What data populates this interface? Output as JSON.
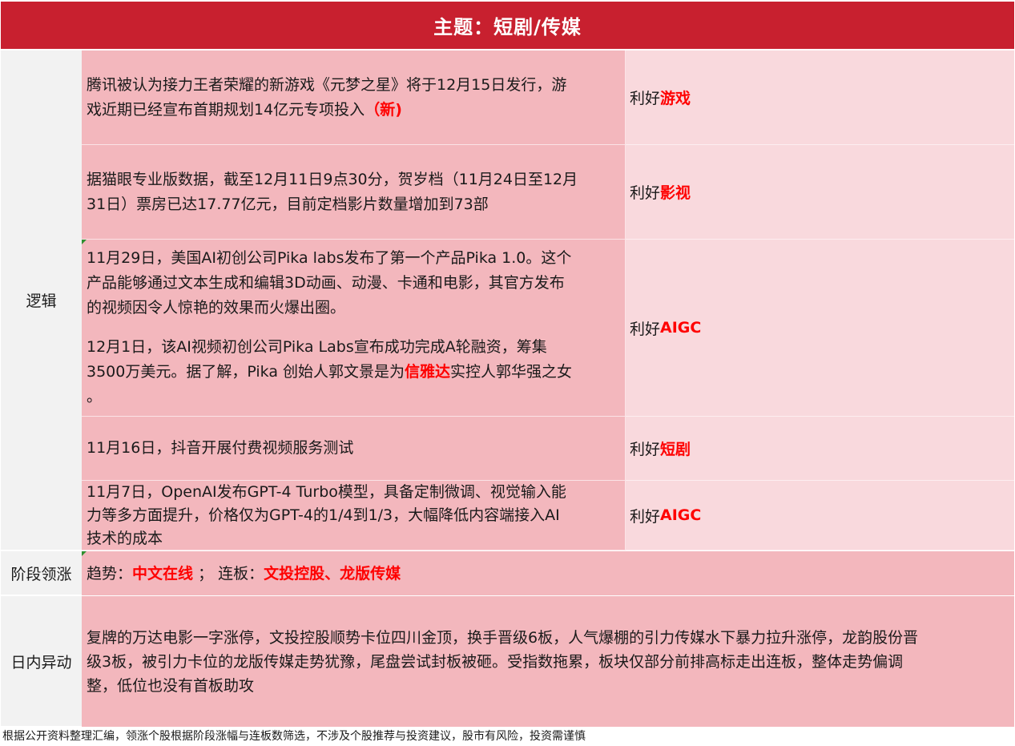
{
  "header": {
    "title": "主题：短剧/传媒"
  },
  "labels": {
    "logic": "逻辑",
    "stage": "阶段领涨",
    "intraday": "日内异动"
  },
  "rows": [
    {
      "lines": [
        "腾讯被认为接力王者荣耀的新游戏《元梦之星》将于12月15日发行，游",
        "戏近期已经宣布首期规划14亿元专项投入"
      ],
      "tag": "（新)",
      "impact_prefix": "利好",
      "impact_target": "游戏"
    },
    {
      "lines": [
        "据猫眼专业版数据，截至12月11日9点30分，贺岁档（11月24日至12月",
        "31日）票房已达17.77亿元，目前定档影片数量增加到73部"
      ],
      "impact_prefix": "利好",
      "impact_target": "影视"
    },
    {
      "para1": [
        "11月29日，美国AI初创公司Pika labs发布了第一个产品Pika 1.0。这个",
        "产品能够通过文本生成和编辑3D动画、动漫、卡通和电影，其官方发布",
        "的视频因令人惊艳的效果而火爆出圈。"
      ],
      "para2_line1": "12月1日，该AI视频初创公司Pika Labs宣布成功完成A轮融资，筹集",
      "para2_line2_pre": "3500万美元。据了解，Pika 创始人郭文景是为",
      "para2_highlight": "信雅达",
      "para2_line2_post": "实控人郭华强之女",
      "para2_line3": "。",
      "impact_prefix": "利好",
      "impact_target": "AIGC"
    },
    {
      "lines": [
        "11月16日，抖音开展付费视频服务测试"
      ],
      "impact_prefix": "利好",
      "impact_target": "短剧"
    },
    {
      "lines": [
        "11月7日，OpenAI发布GPT-4 Turbo模型，具备定制微调、视觉输入能",
        "力等多方面提升，价格仅为GPT-4的1/4到1/3，大幅降低内容端接入AI",
        "技术的成本"
      ],
      "impact_prefix": "利好",
      "impact_target": "AIGC"
    }
  ],
  "stage": {
    "trend_label": "趋势：",
    "trend_value": "中文在线",
    "separator": "；",
    "board_label": "连板：",
    "board_value": "文投控股、龙版传媒"
  },
  "intraday": {
    "lines": [
      "复牌的万达电影一字涨停，文投控股顺势卡位四川金顶，换手晋级6板，人气爆棚的引力传媒水下暴力拉升涨停，龙韵股份晋",
      "级3板，被引力卡位的龙版传媒走势犹豫，尾盘尝试封板被砸。受指数拖累，板块仅部分前排高标走出连板，整体走势偏调",
      "整，低位也没有首板助攻"
    ]
  },
  "footer": {
    "disclaimer": "根据公开资料整理汇编，领涨个股根据阶段涨幅与连板数筛选，不涉及个股推荐与投资建议，股市有风险，投资需谨慎"
  },
  "colors": {
    "header_bg": "#c8202f",
    "highlight_red": "#ff0000",
    "logic_bg": "#f3b7bd",
    "impact_bg": "#f9d9dd",
    "label_bg": "#f2f2f2"
  }
}
